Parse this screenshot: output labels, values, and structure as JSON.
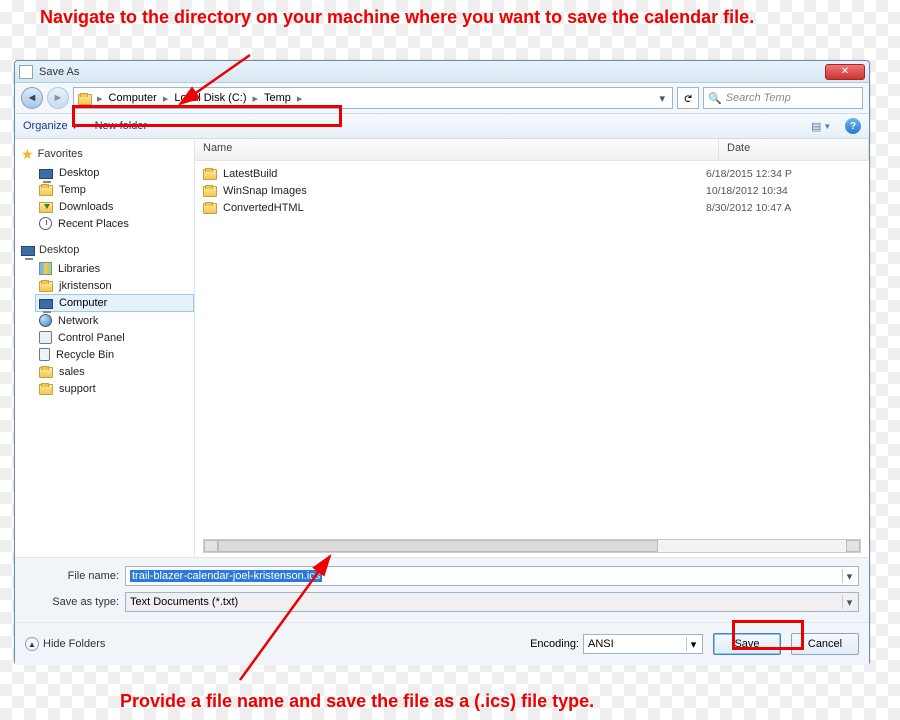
{
  "annotations": {
    "top": "Navigate to the directory on your machine where you want to save the calendar file.",
    "bottom": "Provide a file name and save the file as a (.ics) file type."
  },
  "title": "Save As",
  "breadcrumb": [
    "Computer",
    "Local Disk (C:)",
    "Temp"
  ],
  "search_placeholder": "Search Temp",
  "toolbar": {
    "organize": "Organize",
    "newfolder": "New folder"
  },
  "favorites": {
    "label": "Favorites",
    "items": [
      "Desktop",
      "Temp",
      "Downloads",
      "Recent Places"
    ]
  },
  "tree": {
    "label": "Desktop",
    "items": [
      "Libraries",
      "jkristenson",
      "Computer",
      "Network",
      "Control Panel",
      "Recycle Bin",
      "sales",
      "support"
    ]
  },
  "columns": {
    "name": "Name",
    "date": "Date"
  },
  "files": [
    {
      "name": "LatestBuild",
      "date": "6/18/2015 12:34 P"
    },
    {
      "name": "WinSnap Images",
      "date": "10/18/2012 10:34"
    },
    {
      "name": "ConvertedHTML",
      "date": "8/30/2012 10:47 A"
    }
  ],
  "inputs": {
    "filename_label": "File name:",
    "filename_value": "trail-blazer-calendar-joel-kristenson.ics",
    "type_label": "Save as type:",
    "type_value": "Text Documents (*.txt)"
  },
  "footer": {
    "hide": "Hide Folders",
    "encoding_label": "Encoding:",
    "encoding_value": "ANSI",
    "save": "Save",
    "cancel": "Cancel"
  }
}
